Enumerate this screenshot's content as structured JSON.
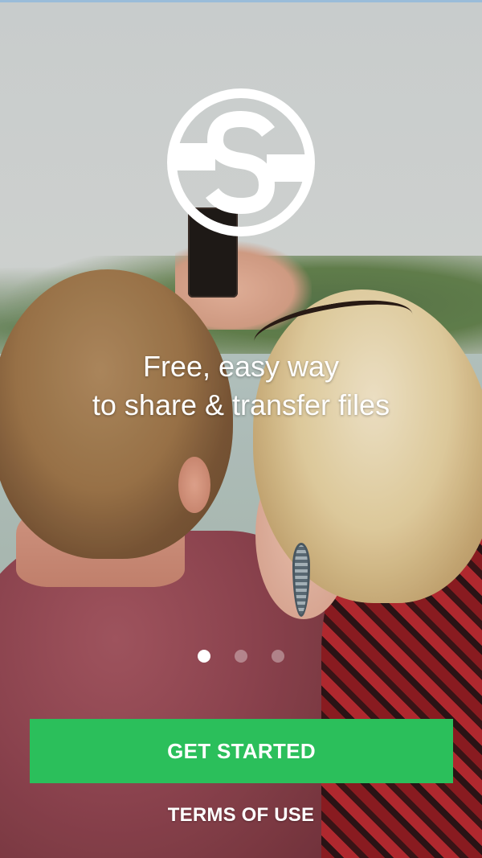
{
  "onboarding": {
    "logo_icon": "s-circle-logo-icon",
    "headline_line1": "Free, easy way",
    "headline_line2": "to share & transfer files",
    "pager": {
      "count": 3,
      "active_index": 0
    },
    "primary_button_label": "GET STARTED",
    "terms_link_label": "TERMS OF USE"
  },
  "colors": {
    "accent": "#2bbf5b",
    "text": "#ffffff"
  }
}
